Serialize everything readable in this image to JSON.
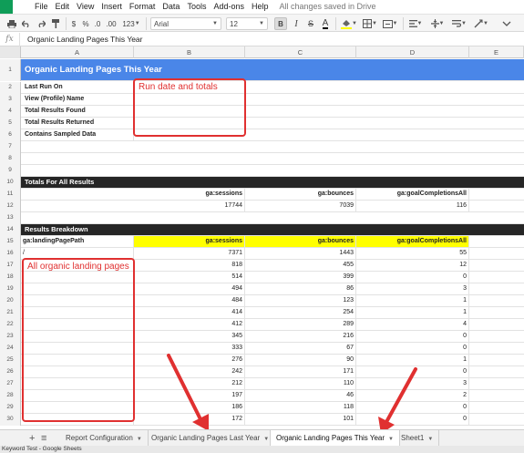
{
  "menu": [
    "File",
    "Edit",
    "View",
    "Insert",
    "Format",
    "Data",
    "Tools",
    "Add-ons",
    "Help"
  ],
  "save_status": "All changes saved in Drive",
  "toolbar": {
    "currency": "$",
    "percent": "%",
    "dec_less": ".0",
    "dec_more": ".00",
    "more_formats": "123",
    "font": "Arial",
    "font_size": "12",
    "bold": "B"
  },
  "formula": {
    "fx": "fx",
    "content": "Organic Landing Pages This Year"
  },
  "columns": [
    "A",
    "B",
    "C",
    "D",
    "E"
  ],
  "title": "Organic Landing Pages This Year",
  "info_rows": [
    {
      "num": "2",
      "label": "Last Run On"
    },
    {
      "num": "3",
      "label": "View (Profile) Name"
    },
    {
      "num": "4",
      "label": "Total Results Found"
    },
    {
      "num": "5",
      "label": "Total Results Returned"
    },
    {
      "num": "6",
      "label": "Contains Sampled Data"
    }
  ],
  "empty_rows": [
    "7",
    "8",
    "9"
  ],
  "totals_section": {
    "num": "10",
    "label": "Totals For All Results",
    "header_num": "11",
    "headers": [
      "ga:sessions",
      "ga:bounces",
      "ga:goalCompletionsAll"
    ],
    "values_num": "12",
    "values": [
      "17744",
      "7039",
      "116"
    ]
  },
  "row13": "13",
  "breakdown_section": {
    "num": "14",
    "label": "Results Breakdown",
    "header_num": "15",
    "dimension": "ga:landingPagePath",
    "metrics": [
      "ga:sessions",
      "ga:bounces",
      "ga:goalCompletionsAll"
    ]
  },
  "data_rows": [
    {
      "num": "16",
      "path": "/",
      "sessions": "7371",
      "bounces": "1443",
      "goals": "55"
    },
    {
      "num": "17",
      "path": "",
      "sessions": "818",
      "bounces": "455",
      "goals": "12"
    },
    {
      "num": "18",
      "path": "",
      "sessions": "514",
      "bounces": "399",
      "goals": "0"
    },
    {
      "num": "19",
      "path": "",
      "sessions": "494",
      "bounces": "86",
      "goals": "3"
    },
    {
      "num": "20",
      "path": "",
      "sessions": "484",
      "bounces": "123",
      "goals": "1"
    },
    {
      "num": "21",
      "path": "",
      "sessions": "414",
      "bounces": "254",
      "goals": "1"
    },
    {
      "num": "22",
      "path": "",
      "sessions": "412",
      "bounces": "289",
      "goals": "4"
    },
    {
      "num": "23",
      "path": "",
      "sessions": "345",
      "bounces": "216",
      "goals": "0"
    },
    {
      "num": "24",
      "path": "",
      "sessions": "333",
      "bounces": "67",
      "goals": "0"
    },
    {
      "num": "25",
      "path": "",
      "sessions": "276",
      "bounces": "90",
      "goals": "1"
    },
    {
      "num": "26",
      "path": "",
      "sessions": "242",
      "bounces": "171",
      "goals": "0"
    },
    {
      "num": "27",
      "path": "",
      "sessions": "212",
      "bounces": "110",
      "goals": "3"
    },
    {
      "num": "28",
      "path": "",
      "sessions": "197",
      "bounces": "46",
      "goals": "2"
    },
    {
      "num": "29",
      "path": "",
      "sessions": "186",
      "bounces": "118",
      "goals": "0"
    },
    {
      "num": "30",
      "path": "",
      "sessions": "172",
      "bounces": "101",
      "goals": "0"
    }
  ],
  "annotations": {
    "run_date": "Run date and totals",
    "landing_pages": "All organic landing pages"
  },
  "tabs": {
    "add": "+",
    "list": "≡",
    "items": [
      "Report Configuration",
      "Organic Landing Pages Last Year",
      "Organic Landing Pages This Year",
      "Sheet1"
    ],
    "active_index": 2
  },
  "status_bar": "Keyword Test - Google Sheets",
  "colors": {
    "title_bg": "#4a86e8",
    "section_bg": "#262626",
    "highlight": "#ffff00",
    "annotation": "#e03030"
  }
}
